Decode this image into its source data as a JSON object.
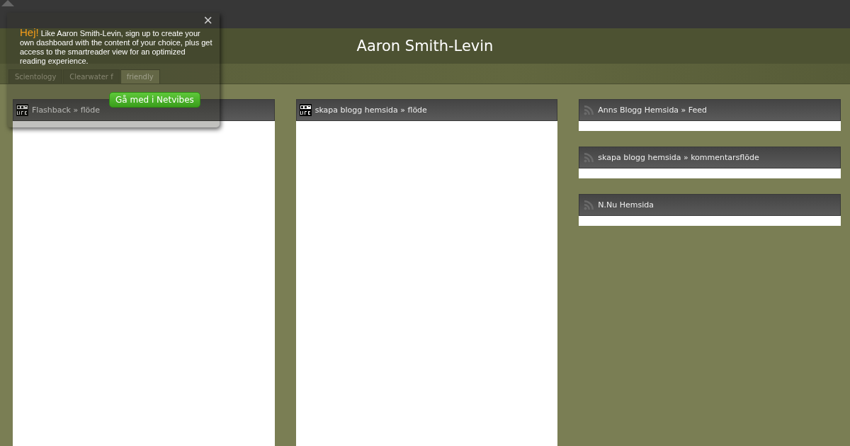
{
  "header": {
    "title": "Aaron Smith-Levin"
  },
  "tabs": [
    {
      "label": "Scientology",
      "selected": false
    },
    {
      "label": "Clearwater f",
      "selected": false
    },
    {
      "label": "friendly",
      "selected": true
    }
  ],
  "columns": [
    {
      "widgets": [
        {
          "title": "Flashback » flöde",
          "kind": "spotlife"
        }
      ]
    },
    {
      "widgets": [
        {
          "title": "skapa blogg hemsida » flöde",
          "kind": "spotlife"
        }
      ]
    },
    {
      "widgets": [
        {
          "title": "Anns Blogg Hemsida » Feed",
          "kind": "rss"
        },
        {
          "title": "skapa blogg hemsida » kommentarsflöde",
          "kind": "rss"
        },
        {
          "title": "N.Nu Hemsida",
          "kind": "rss"
        }
      ]
    }
  ],
  "popup": {
    "greeting": "Hej!",
    "message": "Like Aaron Smith-Levin, sign up to create your own dashboard with the content of your choice, plus get access to the smartreader view for an optimized reading experience.",
    "button": "Gå med i Netvibes",
    "close": "×"
  }
}
